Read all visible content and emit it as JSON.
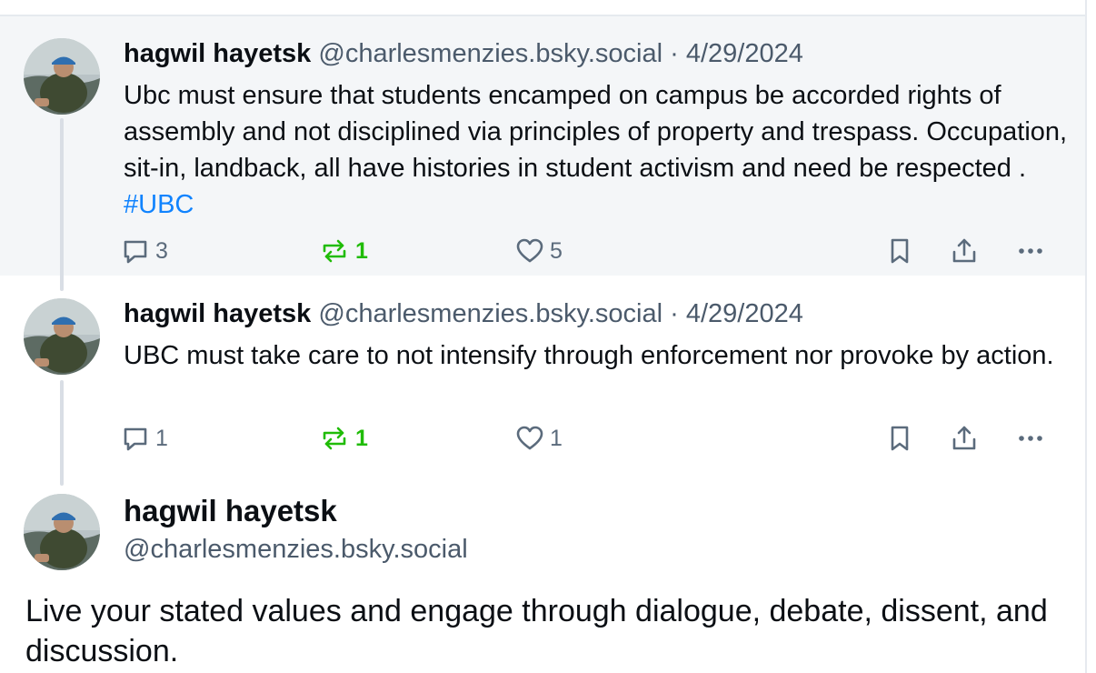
{
  "posts": [
    {
      "author_name": "hagwil hayetsk",
      "handle": "@charlesmenzies.bsky.social",
      "separator": "·",
      "date": "4/29/2024",
      "text": "Ubc must ensure that students encamped on campus be accorded rights of assembly and not disciplined via principles of property and trespass. Occupation, sit-in, landback, all have histories in student activism and need be respected .",
      "hashtag": "#UBC",
      "reply_count": "3",
      "repost_count": "1",
      "like_count": "5"
    },
    {
      "author_name": "hagwil hayetsk",
      "handle": "@charlesmenzies.bsky.social",
      "separator": "·",
      "date": "4/29/2024",
      "text": "UBC must take care to not intensify through enforcement nor provoke by action.",
      "reply_count": "1",
      "repost_count": "1",
      "like_count": "1"
    }
  ],
  "focused_post": {
    "author_name": "hagwil hayetsk",
    "handle": "@charlesmenzies.bsky.social",
    "text": "Live your stated values and engage through dialogue, debate, dissent, and discussion."
  },
  "icons": {
    "reply": "reply-icon",
    "repost": "repost-icon",
    "like": "like-icon",
    "bookmark": "bookmark-icon",
    "share": "share-icon",
    "more": "more-icon"
  },
  "colors": {
    "accent": "#1083fe",
    "repost_green": "#20bc07",
    "muted_text": "#4b5a6b",
    "highlight_bg": "#f4f6f8"
  }
}
